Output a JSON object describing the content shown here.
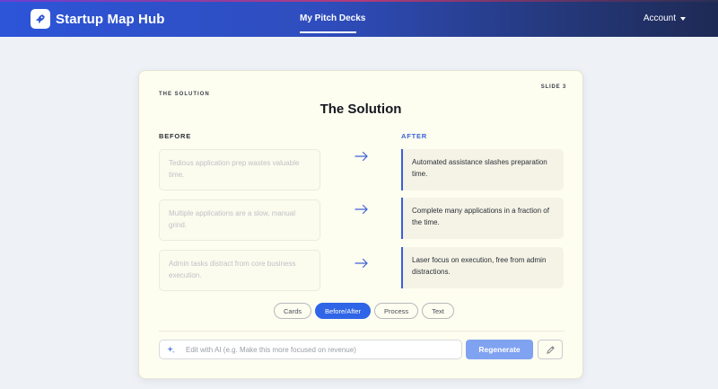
{
  "header": {
    "brand": "Startup Map Hub",
    "nav_active": "My Pitch Decks",
    "account": "Account"
  },
  "slide": {
    "eyebrow": "THE SOLUTION",
    "number": "SLIDE 3",
    "title": "The Solution",
    "before_label": "BEFORE",
    "after_label": "AFTER",
    "rows": [
      {
        "before": "Tedious application prep wastes valuable time.",
        "after": "Automated assistance slashes preparation time."
      },
      {
        "before": "Multiple applications are a slow, manual grind.",
        "after": "Complete many applications in a fraction of the time."
      },
      {
        "before": "Admin tasks distract from core business execution.",
        "after": "Laser focus on execution, free from admin distractions."
      }
    ]
  },
  "layout_tabs": {
    "items": [
      "Cards",
      "Before/After",
      "Process",
      "Text"
    ],
    "selected": "Before/After"
  },
  "ai_edit": {
    "placeholder": "Edit with AI (e.g. Make this more focused on revenue)",
    "value": "",
    "regenerate_label": "Regenerate"
  },
  "colors": {
    "accent": "#2f65e6",
    "after_border": "#3b5fd8",
    "card_bg": "#fdfdf0",
    "page_bg": "#eef1f6"
  },
  "icons": [
    "rocket-icon",
    "caret-down-icon",
    "arrow-right-icon",
    "sparkle-icon",
    "pencil-icon"
  ]
}
